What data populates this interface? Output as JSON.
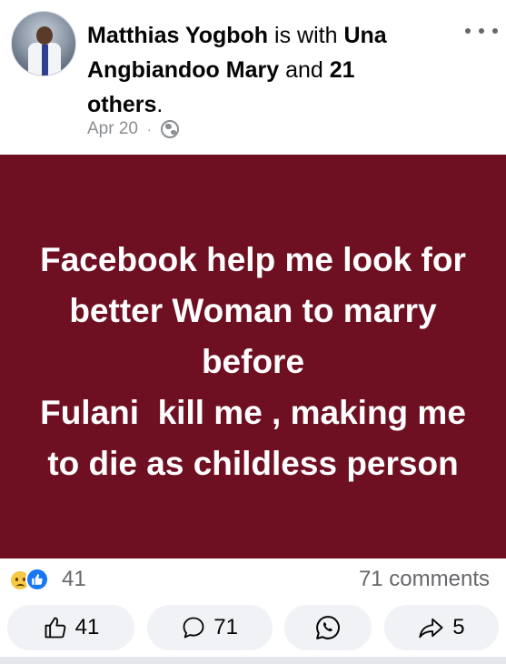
{
  "post": {
    "author": "Matthias Yogboh",
    "with_text": "is with",
    "tagged_name": "Una Angbiandoo Mary",
    "and_text": "and",
    "others_count": "21",
    "others_label": "others",
    "date": "Apr 20",
    "separator": "·",
    "privacy_icon": "globe-icon",
    "text_lines": [
      "Facebook help me look for",
      "better Woman to marry",
      "before",
      "Fulani  kill me , making me",
      "to die as childless person"
    ],
    "background_color": "#6e0f22"
  },
  "stats": {
    "reaction_icons": [
      "sad-icon",
      "like-icon"
    ],
    "reaction_count": "41",
    "comments_count": "71 comments"
  },
  "actions": {
    "like_count": "41",
    "comment_count": "71",
    "share_count": "5"
  }
}
